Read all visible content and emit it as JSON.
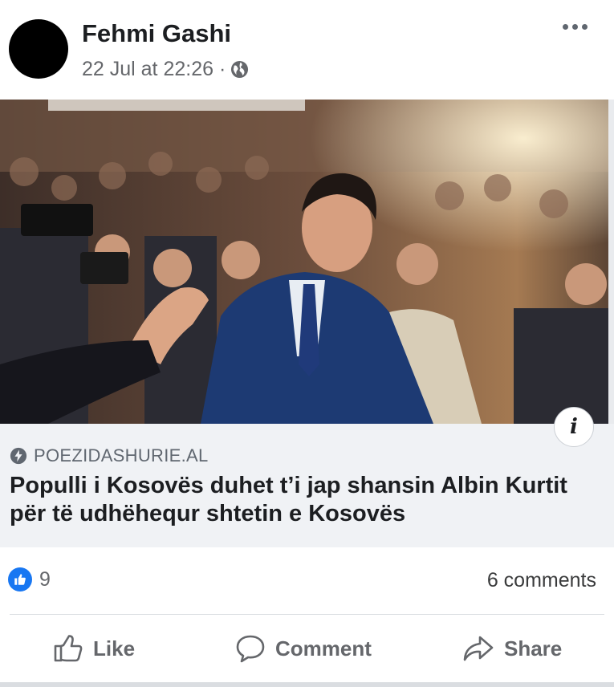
{
  "post": {
    "author": "Fehmi Gashi",
    "timestamp": "22 Jul at 22:26",
    "separator": "·",
    "privacy_icon": "globe-icon",
    "more_icon": "more-options-icon"
  },
  "link_preview": {
    "domain": "POEZIDASHURIE.AL",
    "headline": "Populli i Kosovës duhet t’i jap shansin Albin Kurtit për të udhëhequr shtetin e Kosovës",
    "info_label": "i"
  },
  "stats": {
    "like_count": "9",
    "comments": "6 comments"
  },
  "actions": {
    "like": "Like",
    "comment": "Comment",
    "share": "Share"
  },
  "colors": {
    "accent": "#1877f2",
    "muted_text": "#65676b",
    "link_box_bg": "#f0f2f5"
  }
}
